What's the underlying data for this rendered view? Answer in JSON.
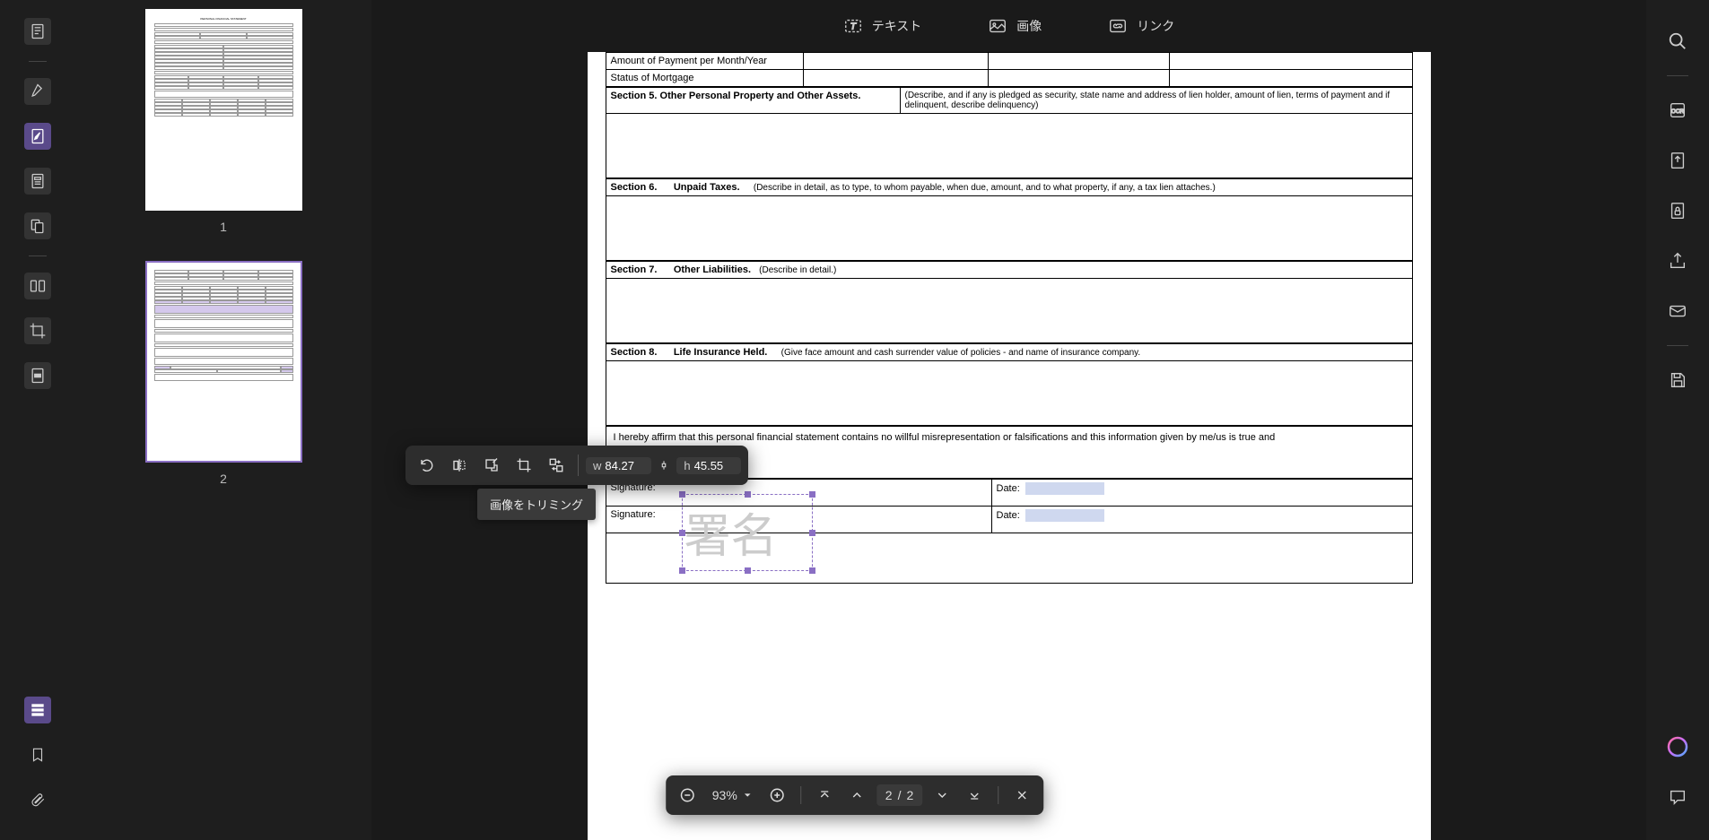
{
  "top_toolbar": {
    "text_label": "テキスト",
    "image_label": "画像",
    "link_label": "リンク"
  },
  "thumbnails": {
    "page1_label": "1",
    "page2_label": "2"
  },
  "document": {
    "row1_label": "Amount of Payment per Month/Year",
    "row2_label": "Status of Mortgage",
    "section5_title": "Section 5. Other Personal Property and Other Assets.",
    "section5_desc": "(Describe, and if any is pledged as security, state name and address of lien holder, amount of lien, terms of payment and if delinquent, describe delinquency)",
    "section6_num": "Section 6.",
    "section6_title": "Unpaid Taxes.",
    "section6_desc": "(Describe in detail, as to type, to whom payable, when due, amount, and to what property, if any, a tax lien attaches.)",
    "section7_num": "Section 7.",
    "section7_title": "Other Liabilities.",
    "section7_desc": "(Describe in detail.)",
    "section8_num": "Section 8.",
    "section8_title": "Life Insurance Held.",
    "section8_desc": "(Give face amount and cash surrender value of policies - and name of insurance company.",
    "affirm_text": "I hereby affirm that this personal financial statement contains no willful misrepresentation or falsifications and this information given by me/us is true and",
    "signature1_label": "Signature:",
    "signature2_label": "Signature:",
    "date1_label": "Date:",
    "date2_label": "Date:",
    "signature_image_text": "署名"
  },
  "image_toolbar": {
    "w_label": "w",
    "w_value": "84.27",
    "h_label": "h",
    "h_value": "45.55",
    "tooltip": "画像をトリミング"
  },
  "bottom_toolbar": {
    "zoom": "93%",
    "current_page": "2",
    "separator": "/",
    "total_pages": "2"
  }
}
